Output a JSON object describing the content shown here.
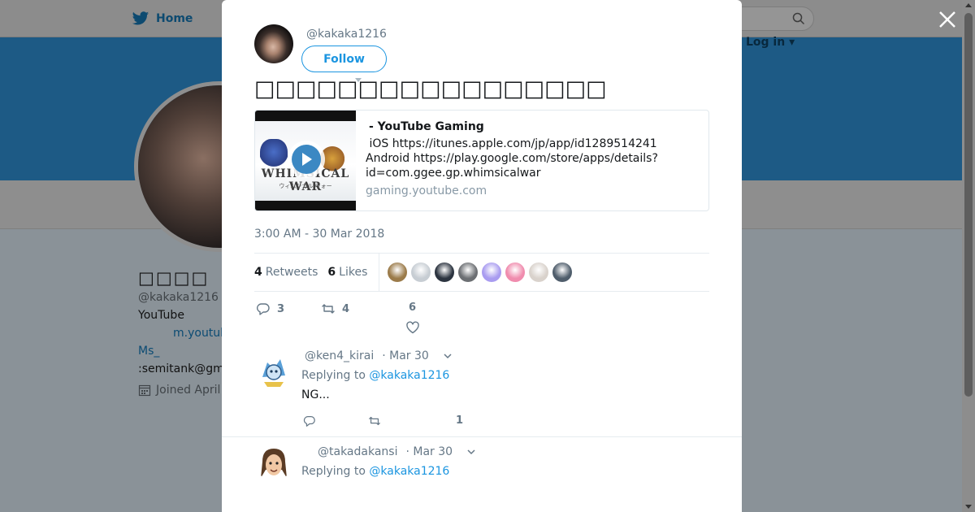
{
  "background": {
    "nav_home_label": "Home",
    "login_label": "Log in",
    "profile_name": "□□□□",
    "profile_handle": "@kakaka1216",
    "bio_line1": "YouTube",
    "bio_link": "m.youtub",
    "bio_line3": "Ms_",
    "bio_line4": ":semitank@gm",
    "joined": "Joined April"
  },
  "tweet": {
    "author_handle": "@kakaka1216",
    "follow_label": "Follow",
    "text": "□□□□□□□□□□□□□□□□□",
    "card": {
      "title": "- YouTube Gaming",
      "description": " iOS https://itunes.apple.com/jp/app/id1289514241\nAndroid https://play.google.com/store/apps/details?\nid=com.ggee.gp.whimsicalwar",
      "domain": "gaming.youtube.com",
      "thumb_logo": "WHIMSICAL WAR",
      "thumb_sub": "ウィムジカル ウォー"
    },
    "timestamp": "3:00 AM - 30 Mar 2018",
    "retweets_count": "4",
    "retweets_label": "Retweets",
    "likes_count": "6",
    "likes_label": "Likes",
    "likers": [
      {
        "color": "#9b7b4a"
      },
      {
        "color": "#c7cdd3"
      },
      {
        "color": "#2c3440"
      },
      {
        "color": "#6c6f73"
      },
      {
        "color": "#a99cf0"
      },
      {
        "color": "#f08cae"
      },
      {
        "color": "#d9d2cc"
      },
      {
        "color": "#4f5d6b"
      }
    ],
    "actions": {
      "reply_count": "3",
      "retweet_count": "4",
      "like_count": "6"
    }
  },
  "replies": [
    {
      "handle": "@ken4_kirai",
      "date": "· Mar 30",
      "replying_prefix": "Replying to",
      "replying_to": "@kakaka1216",
      "text": "NG...",
      "like_count": "1"
    },
    {
      "handle": "@takadakansi",
      "date": "· Mar 30",
      "replying_prefix": "Replying to",
      "replying_to": "@kakaka1216",
      "text": ""
    }
  ]
}
